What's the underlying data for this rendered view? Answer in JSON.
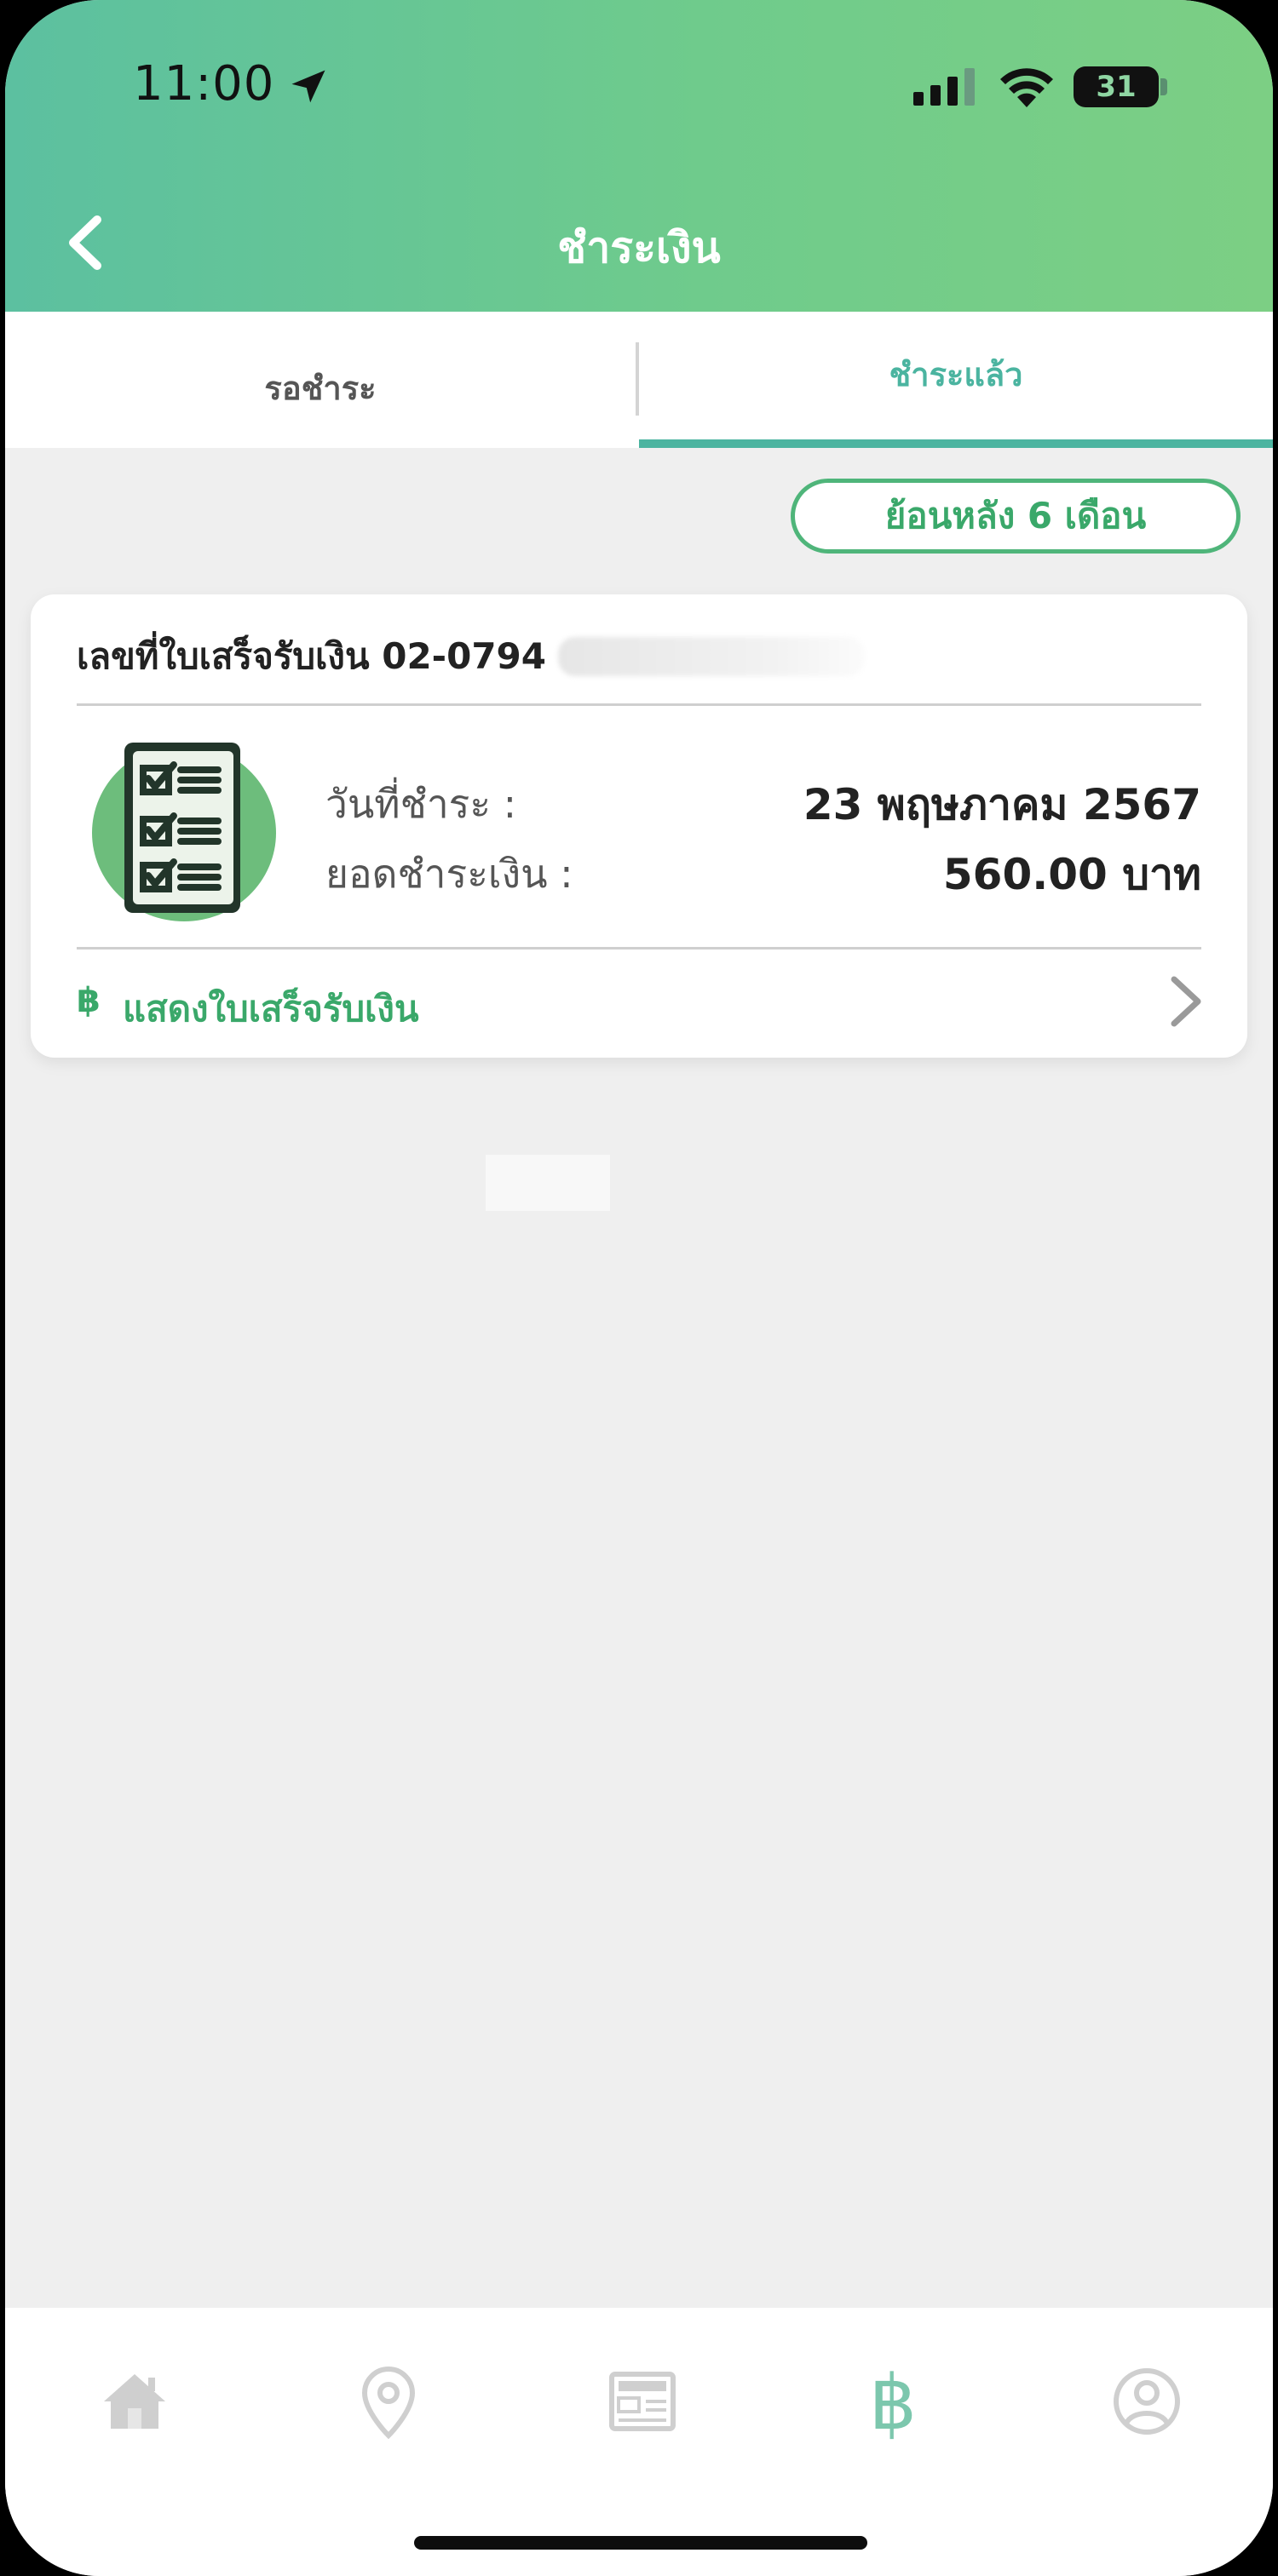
{
  "status_bar": {
    "time": "11:00",
    "battery": "31"
  },
  "header": {
    "title": "ชำระเงิน"
  },
  "tabs": [
    {
      "label": "รอชำระ"
    },
    {
      "label": "ชำระแล้ว"
    }
  ],
  "filter": {
    "label": "ย้อนหลัง 6 เดือน"
  },
  "receipt_card": {
    "receipt_no_label": "เลขที่ใบเสร็จรับเงิน 02-0794",
    "date_label": "วันที่ชำระ :",
    "date_value": "23 พฤษภาคม 2567",
    "amount_label": "ยอดชำระเงิน :",
    "amount_value": "560.00 บาท",
    "show_receipt_symbol": "฿",
    "show_receipt_label": "แสดงใบเสร็จรับเงิน"
  },
  "colors": {
    "accent_green": "#3aa86a",
    "tab_active": "#4bb4a0",
    "header_gradient_start": "#5cc0a0",
    "header_gradient_end": "#7ccf84"
  },
  "bottom_nav": [
    {
      "icon": "home-icon"
    },
    {
      "icon": "map-pin-icon"
    },
    {
      "icon": "news-icon"
    },
    {
      "icon": "baht-icon"
    },
    {
      "icon": "profile-icon"
    }
  ]
}
